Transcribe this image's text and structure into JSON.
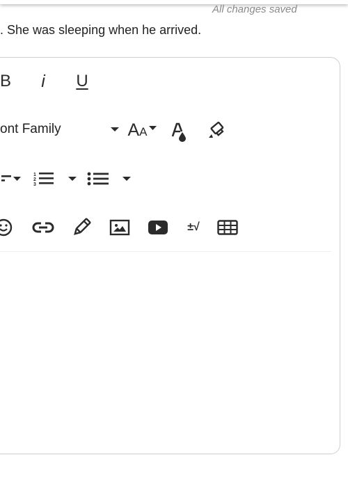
{
  "status": {
    "saved_text": "All changes saved"
  },
  "content": {
    "sentence": ". She was sleeping when he arrived."
  },
  "toolbar": {
    "bold_label": "B",
    "italic_label": "i",
    "underline_label": "U",
    "font_family_label": "ont Family",
    "font_size_label_big": "A",
    "font_size_label_small": "A",
    "math_label": "±√"
  },
  "colors": {
    "icon": "#2b2b2b",
    "border": "#cfcfcf",
    "saved_text": "#8a8a8a"
  }
}
